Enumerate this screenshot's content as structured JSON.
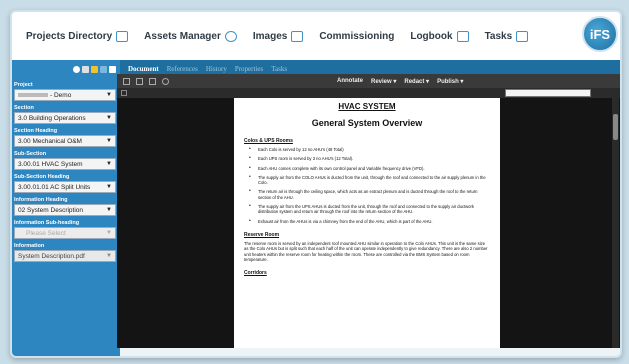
{
  "nav": {
    "items": [
      {
        "label": "Projects Directory",
        "icon": "folder-icon"
      },
      {
        "label": "Assets Manager",
        "icon": "link-icon"
      },
      {
        "label": "Images",
        "icon": "image-icon"
      },
      {
        "label": "Commissioning",
        "icon": ""
      },
      {
        "label": "Logbook",
        "icon": "book-icon"
      },
      {
        "label": "Tasks",
        "icon": "calendar-icon"
      }
    ],
    "logo_text": "iFS"
  },
  "subnav": {
    "tabs": [
      "Document",
      "References",
      "History",
      "Properties",
      "Tasks"
    ]
  },
  "sidebar": {
    "fields": [
      {
        "label": "Project",
        "value": "- Demo"
      },
      {
        "label": "Section",
        "value": "3.0 Building Operations"
      },
      {
        "label": "Section Heading",
        "value": "3.00 Mechanical O&M"
      },
      {
        "label": "Sub-Section",
        "value": "3.00.01 HVAC System"
      },
      {
        "label": "Sub-Section Heading",
        "value": "3.00.01.01 AC Split Units"
      },
      {
        "label": "Information Heading",
        "value": "02 System Description"
      },
      {
        "label": "Information Sub-heading",
        "value": "Please Select"
      },
      {
        "label": "Information",
        "value": "System Description.pdf"
      }
    ]
  },
  "viewer": {
    "menu": [
      "Annotate",
      "Review",
      "Redact",
      "Publish"
    ]
  },
  "document": {
    "title": "HVAC SYSTEM",
    "subtitle": "General System Overview",
    "section1_heading": "Colos & UPS Rooms",
    "bullets": [
      "Each Colo is served by 12 no AHU's (48 Total)",
      "Each UPS room is served by 3 no AHU's (12 Total).",
      "Each AHU comes complete with its own control panel and Variable frequency drive (VFD).",
      "The supply air from the COLO AHUs is ducted from the unit, through the roof and connected to the air supply plenum in the Colo.",
      "The return air is through the ceiling space, which acts as an extract plenum and is ducted through the roof to the return section of the AHU.",
      "The supply air from the UPS AHUs is ducted from the unit, through the roof and connected to the supply air ductwork distribution system and return air through the roof into the return section of the AHU.",
      "Exhaust air from the AHUs is via a chimney from the end of the AHU, which is part of the AHU."
    ],
    "section2_heading": "Reserve Room",
    "section2_text": "The reserve room is served by an independent roof mounted AHU similar in operation to the Colo AHUs. This unit is the same size as the Colo AHUs but is split such that each half of the unit can operate independently to give redundancy. There are also 2 number unit heaters within the reserve room for heating within the room. These are controlled via the BMS System based on room temperature.",
    "section3_heading": "Corridors"
  }
}
